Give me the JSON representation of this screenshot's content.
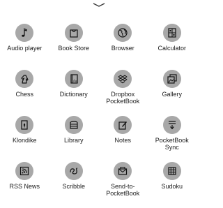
{
  "apps": [
    {
      "label": "Audio player",
      "icon": "music-note-icon"
    },
    {
      "label": "Book Store",
      "icon": "shopping-bag-icon"
    },
    {
      "label": "Browser",
      "icon": "globe-icon"
    },
    {
      "label": "Calculator",
      "icon": "calculator-icon"
    },
    {
      "label": "Chess",
      "icon": "chess-knight-icon"
    },
    {
      "label": "Dictionary",
      "icon": "dictionary-book-icon"
    },
    {
      "label": "Dropbox\nPocketBook",
      "icon": "dropbox-icon"
    },
    {
      "label": "Gallery",
      "icon": "gallery-icon"
    },
    {
      "label": "Klondike",
      "icon": "playing-card-icon"
    },
    {
      "label": "Library",
      "icon": "library-books-icon"
    },
    {
      "label": "Notes",
      "icon": "notes-pencil-icon"
    },
    {
      "label": "PocketBook\nSync",
      "icon": "sync-download-icon"
    },
    {
      "label": "RSS News",
      "icon": "rss-icon"
    },
    {
      "label": "Scribble",
      "icon": "scribble-icon"
    },
    {
      "label": "Send-to-\nPocketBook",
      "icon": "envelope-icon"
    },
    {
      "label": "Sudoku",
      "icon": "sudoku-grid-icon"
    }
  ],
  "colors": {
    "icon_background": "#a8a8a8",
    "text": "#1a1a1a"
  }
}
